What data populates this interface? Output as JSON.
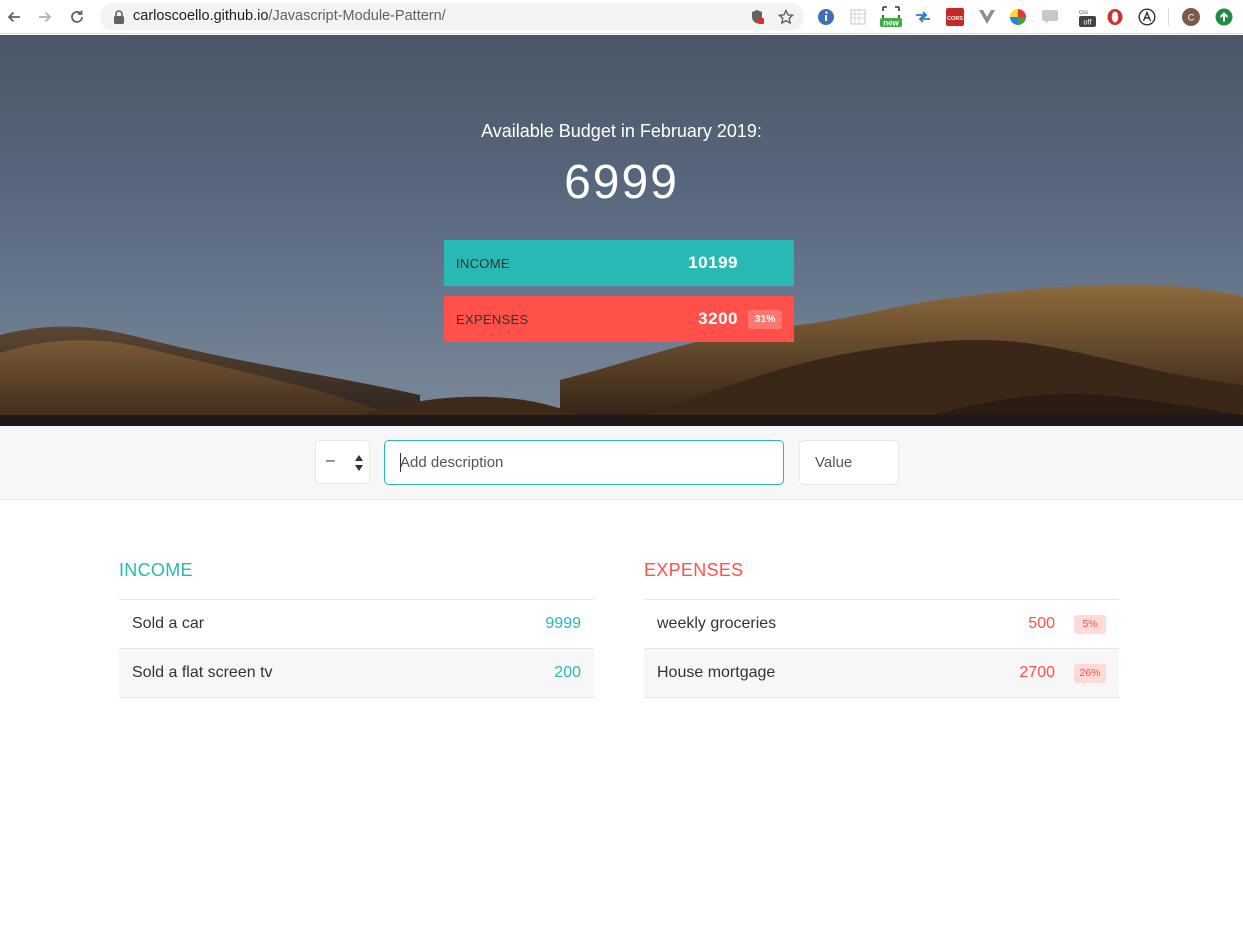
{
  "browser": {
    "url_host": "carloscoello.github.io",
    "url_path": "/Javascript-Module-Pattern/",
    "extensions": [
      "info-icon",
      "grid-icon",
      "new-badge-icon",
      "swap-arrows-icon",
      "cors-icon",
      "vue-icon",
      "colorwheel-icon",
      "chat-icon",
      "css-off-icon",
      "opera-icon",
      "accessibility-icon",
      "profile-avatar",
      "update-icon"
    ],
    "ext_labels": {
      "new": "new",
      "cors": "CORS",
      "off": "off",
      "profile": "C"
    }
  },
  "budget": {
    "title": "Available Budget in February 2019:",
    "value": "6999",
    "income_label": "INCOME",
    "income_value": "10199",
    "expenses_label": "EXPENSES",
    "expenses_value": "3200",
    "expenses_percentage": "31%"
  },
  "add": {
    "type_value": "–",
    "description_placeholder": "Add description",
    "value_placeholder": "Value"
  },
  "income": {
    "title": "Income",
    "items": [
      {
        "description": "Sold a car",
        "value": "9999"
      },
      {
        "description": "Sold a flat screen tv",
        "value": "200"
      }
    ]
  },
  "expenses": {
    "title": "Expenses",
    "items": [
      {
        "description": "weekly groceries",
        "value": "500",
        "percentage": "5%"
      },
      {
        "description": "House mortgage",
        "value": "2700",
        "percentage": "26%"
      }
    ]
  },
  "colors": {
    "income": "#28b9b5",
    "expenses": "#ff5049",
    "expense_badge_bg": "#ffdad9"
  }
}
